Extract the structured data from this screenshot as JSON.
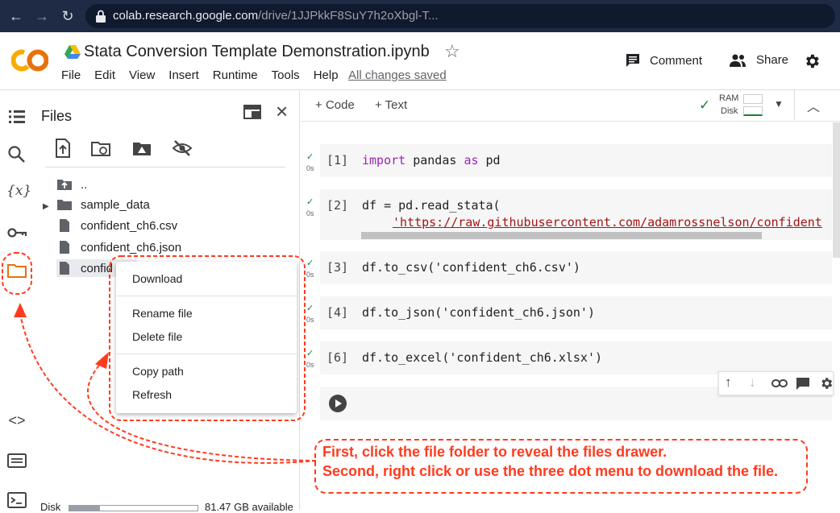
{
  "browser": {
    "url_host": "colab.research.google.com",
    "url_path": "/drive/1JJPkkF8SuY7h2oXbgl-T..."
  },
  "header": {
    "notebook_title": "Stata Conversion Template Demonstration.ipynb",
    "menu": [
      "File",
      "Edit",
      "View",
      "Insert",
      "Runtime",
      "Tools",
      "Help"
    ],
    "save_status": "All changes saved",
    "comment_label": "Comment",
    "share_label": "Share"
  },
  "files_panel": {
    "title": "Files",
    "items": [
      {
        "name": ".."
      },
      {
        "name": "sample_data"
      },
      {
        "name": "confident_ch6.csv"
      },
      {
        "name": "confident_ch6.json"
      },
      {
        "name": "confid"
      }
    ],
    "disk_label": "Disk",
    "disk_available": "81.47 GB available"
  },
  "notebook_toolbar": {
    "add_code": "Code",
    "add_text": "Text",
    "ram_label": "RAM",
    "disk_label": "Disk"
  },
  "cells": [
    {
      "num": "[1]",
      "time": "0s",
      "code": "import pandas as pd"
    },
    {
      "num": "[2]",
      "time": "0s",
      "code_line1": "df = pd.read_stata(",
      "code_line2": "'https://raw.githubusercontent.com/adamrossnelson/confident"
    },
    {
      "num": "[3]",
      "time": "0s",
      "code": "df.to_csv('confident_ch6.csv')"
    },
    {
      "num": "[4]",
      "time": "0s",
      "code": "df.to_json('confident_ch6.json')"
    },
    {
      "num": "[6]",
      "time": "0s",
      "code": "df.to_excel('confident_ch6.xlsx')"
    }
  ],
  "context_menu": {
    "download": "Download",
    "rename": "Rename file",
    "delete": "Delete file",
    "copy_path": "Copy path",
    "refresh": "Refresh"
  },
  "annotation": {
    "line1": "First, click the file folder to reveal the files drawer.",
    "line2": "Second, right click or use the three dot menu to download the file.",
    "color": "#ff3b1f"
  }
}
